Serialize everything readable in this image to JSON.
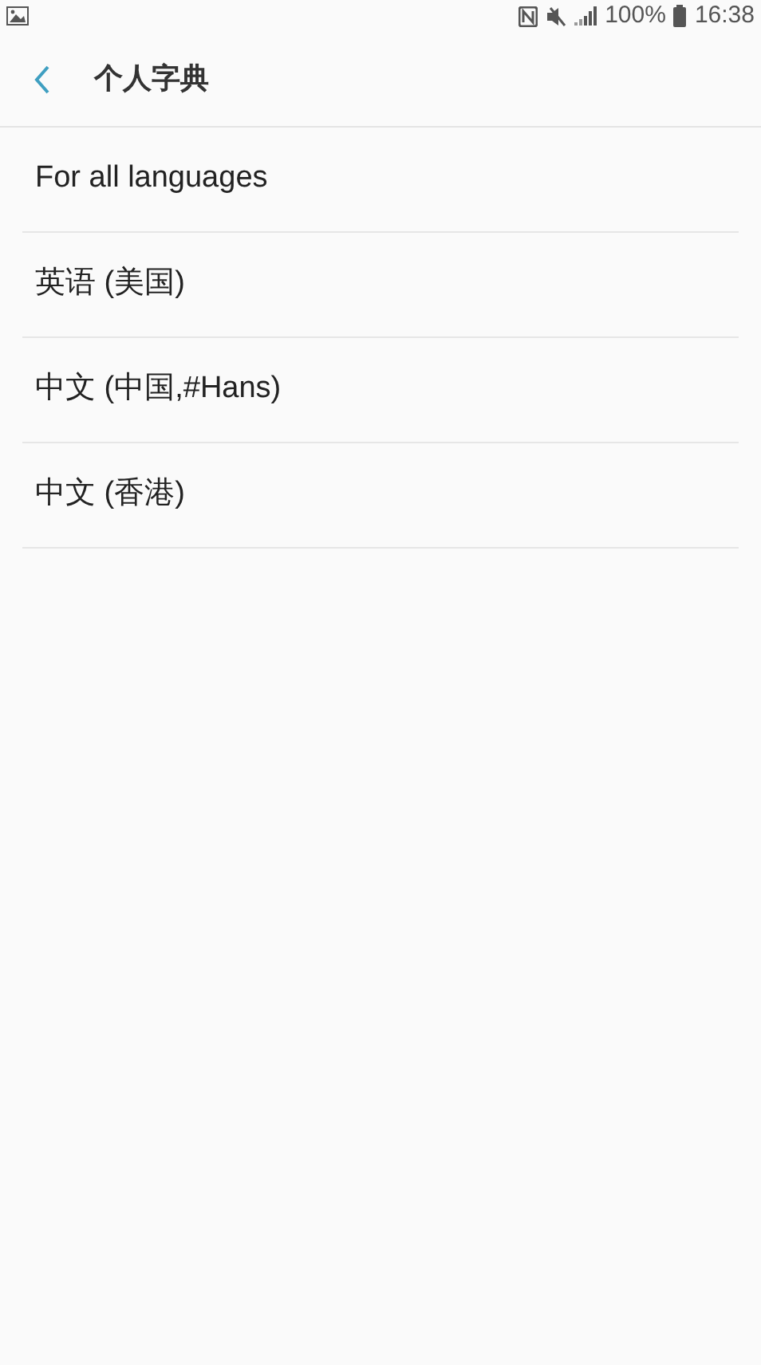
{
  "status_bar": {
    "battery": "100%",
    "time": "16:38"
  },
  "header": {
    "title": "个人字典"
  },
  "items": [
    {
      "label": "For all languages"
    },
    {
      "label": "英语 (美国)"
    },
    {
      "label": "中文 (中国,#Hans)"
    },
    {
      "label": "中文 (香港)"
    }
  ]
}
